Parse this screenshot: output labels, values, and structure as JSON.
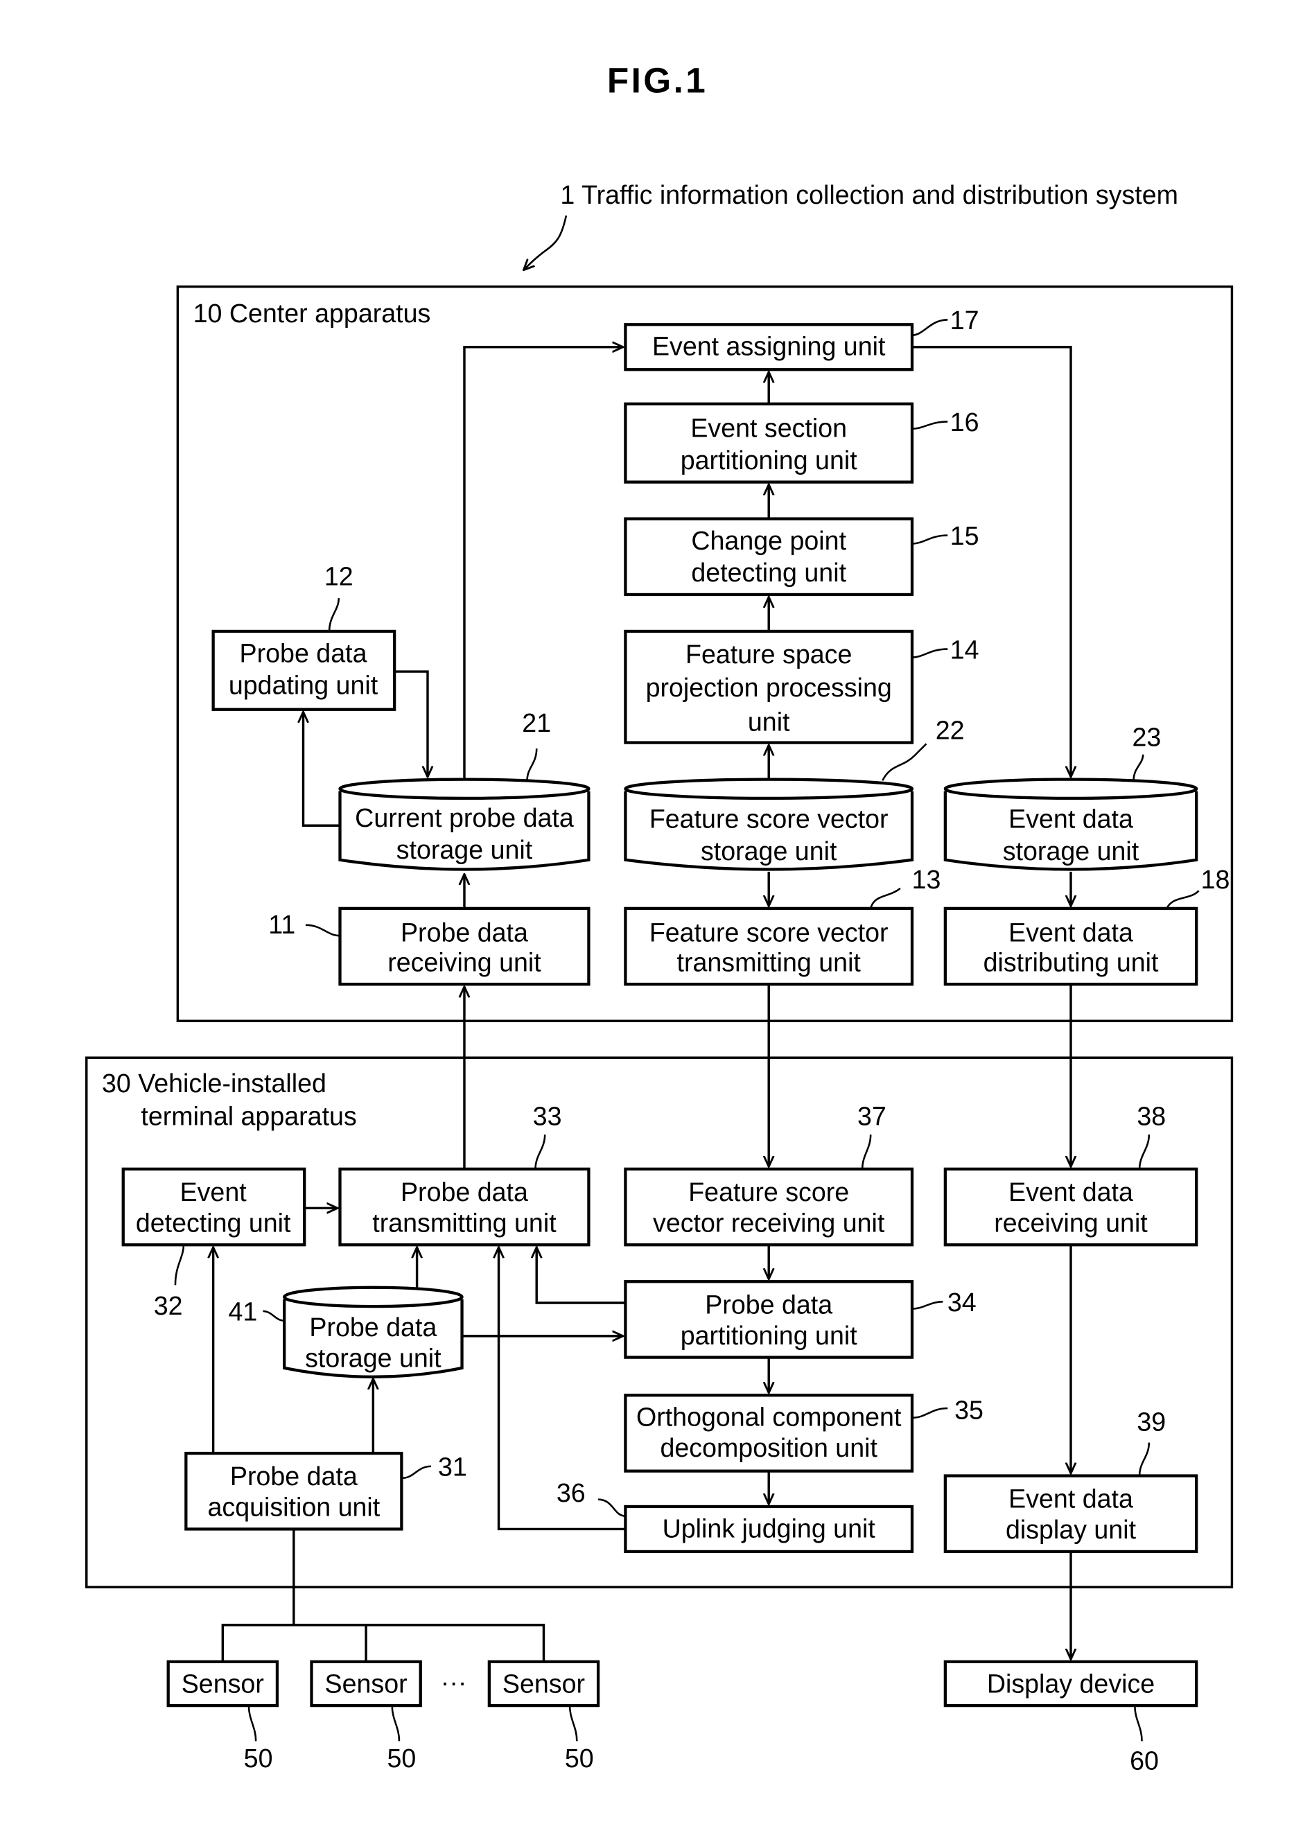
{
  "figure": {
    "title": "FIG.1",
    "system_label": "1 Traffic information collection and distribution system"
  },
  "center": {
    "label": "10 Center apparatus",
    "units": {
      "event_assigning": {
        "lines": [
          "Event assigning unit"
        ],
        "ref": "17"
      },
      "event_section": {
        "lines": [
          "Event section",
          "partitioning unit"
        ],
        "ref": "16"
      },
      "change_point": {
        "lines": [
          "Change point",
          "detecting unit"
        ],
        "ref": "15"
      },
      "feature_space": {
        "lines": [
          "Feature space",
          "projection processing",
          "unit"
        ],
        "ref": "14"
      },
      "probe_updating": {
        "lines": [
          "Probe data",
          "updating unit"
        ],
        "ref": "12"
      },
      "current_probe_storage": {
        "lines": [
          "Current probe data",
          "storage unit"
        ],
        "ref": "21"
      },
      "feature_score_storage": {
        "lines": [
          "Feature score vector",
          "storage unit"
        ],
        "ref": "22"
      },
      "event_data_storage": {
        "lines": [
          "Event data",
          "storage unit"
        ],
        "ref": "23"
      },
      "probe_receiving": {
        "lines": [
          "Probe data",
          "receiving unit"
        ],
        "ref": "11"
      },
      "feature_score_transmitting": {
        "lines": [
          "Feature score vector",
          "transmitting unit"
        ],
        "ref": "13"
      },
      "event_distributing": {
        "lines": [
          "Event data",
          "distributing unit"
        ],
        "ref": "18"
      }
    }
  },
  "vehicle": {
    "label_lines": [
      "30 Vehicle-installed",
      "terminal apparatus"
    ],
    "units": {
      "event_detecting": {
        "lines": [
          "Event",
          "detecting unit"
        ],
        "ref": "32"
      },
      "probe_transmitting": {
        "lines": [
          "Probe data",
          "transmitting unit"
        ],
        "ref": "33"
      },
      "feature_receiving": {
        "lines": [
          "Feature score",
          "vector receiving unit"
        ],
        "ref": "37"
      },
      "event_receiving": {
        "lines": [
          "Event data",
          "receiving unit"
        ],
        "ref": "38"
      },
      "probe_storage": {
        "lines": [
          "Probe data",
          "storage unit"
        ],
        "ref": "41"
      },
      "probe_partitioning": {
        "lines": [
          "Probe data",
          "partitioning unit"
        ],
        "ref": "34"
      },
      "orthogonal": {
        "lines": [
          "Orthogonal component",
          "decomposition unit"
        ],
        "ref": "35"
      },
      "uplink": {
        "lines": [
          "Uplink judging unit"
        ],
        "ref": "36"
      },
      "probe_acquisition": {
        "lines": [
          "Probe data",
          "acquisition unit"
        ],
        "ref": "31"
      },
      "event_display": {
        "lines": [
          "Event data",
          "display unit"
        ],
        "ref": "39"
      }
    }
  },
  "external": {
    "sensors": [
      {
        "label": "Sensor",
        "ref": "50"
      },
      {
        "label": "Sensor",
        "ref": "50"
      },
      {
        "label": "Sensor",
        "ref": "50"
      }
    ],
    "ellipsis": "···",
    "display_device": {
      "label": "Display device",
      "ref": "60"
    }
  }
}
